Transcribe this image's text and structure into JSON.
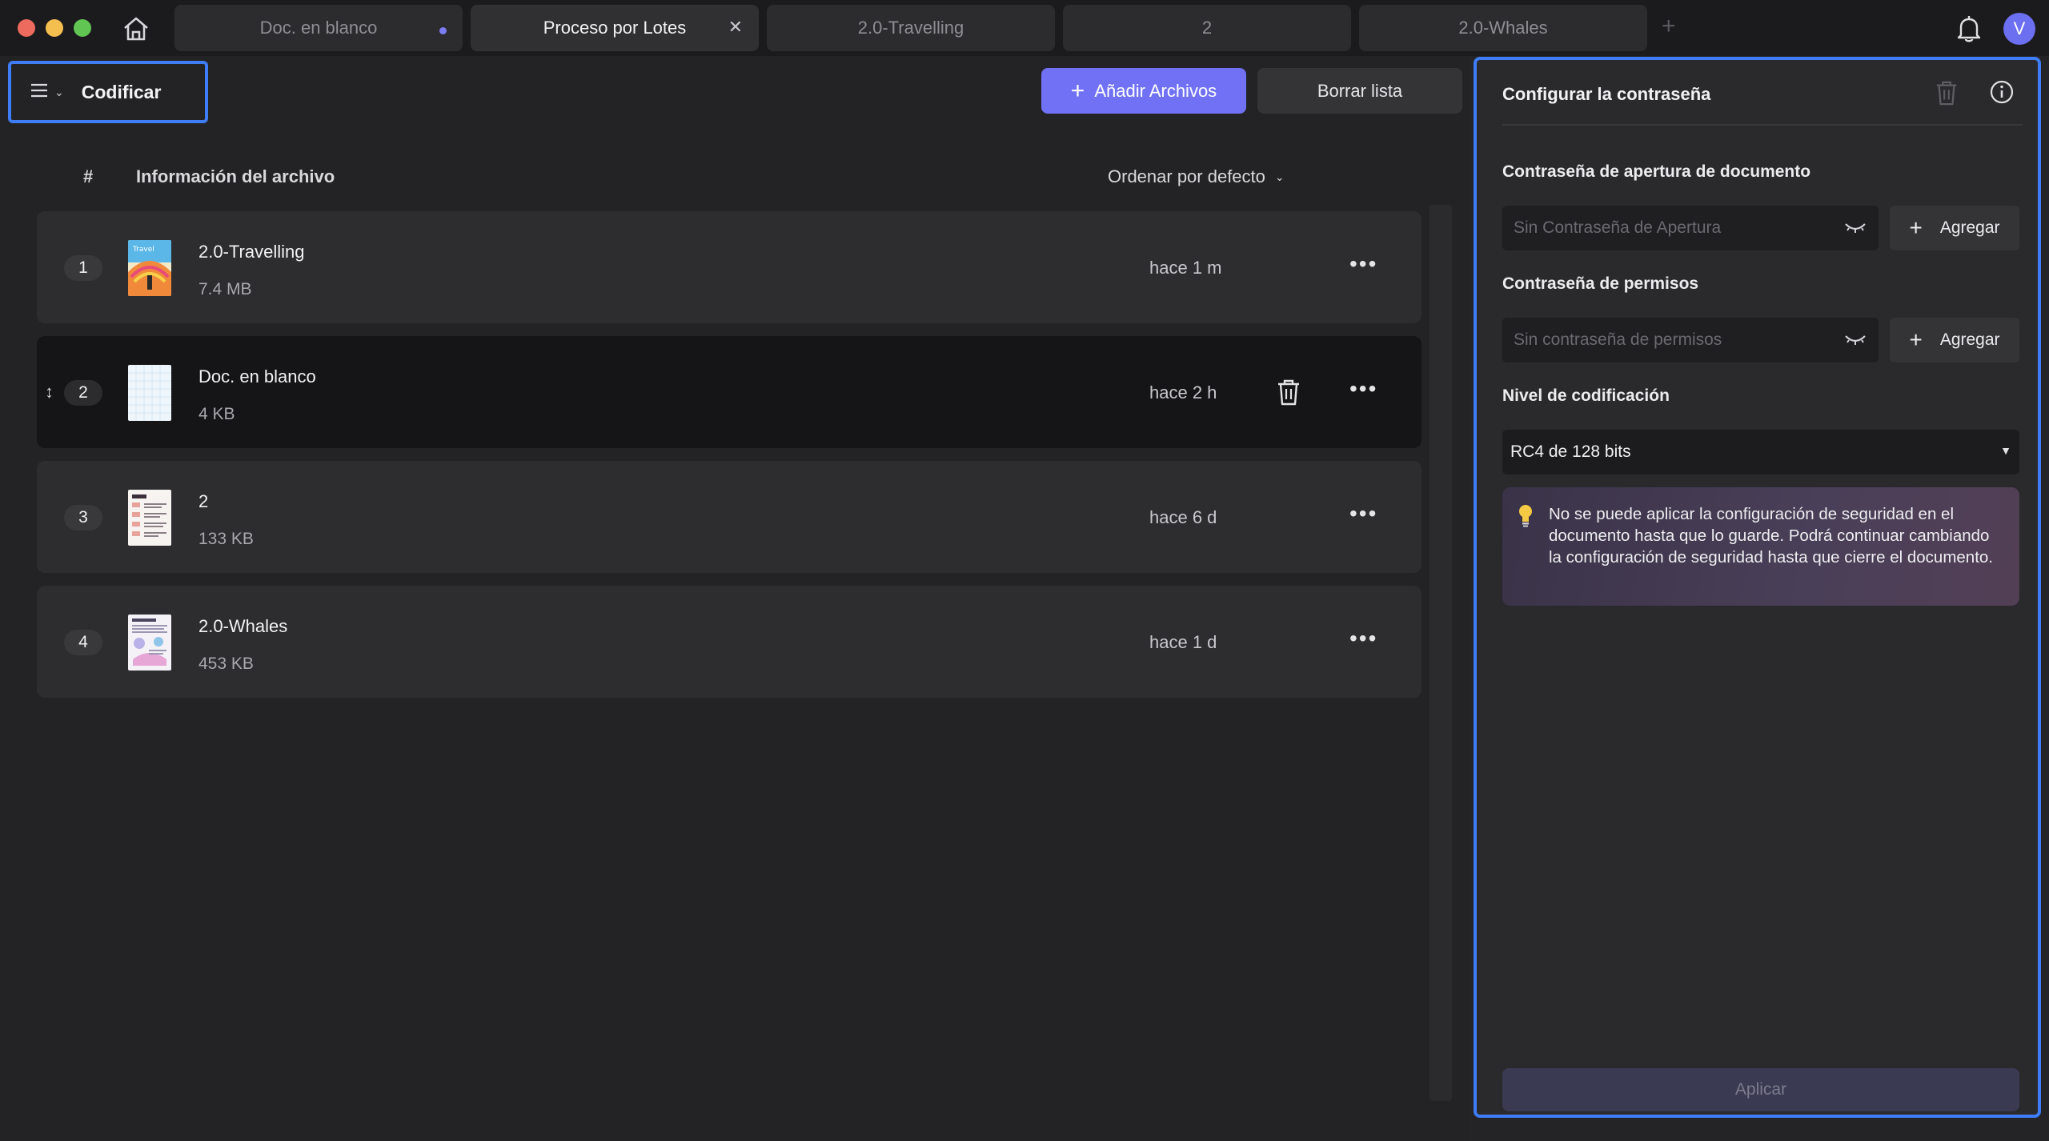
{
  "tabs": [
    {
      "label": "Doc. en blanco",
      "unsaved": true
    },
    {
      "label": "Proceso por Lotes",
      "active": true
    },
    {
      "label": "2.0-Travelling"
    },
    {
      "label": "2"
    },
    {
      "label": "2.0-Whales"
    }
  ],
  "user": {
    "initial": "V"
  },
  "toolbar": {
    "mode_label": "Codificar",
    "add_files_label": "Añadir Archivos",
    "clear_list_label": "Borrar lista"
  },
  "list_header": {
    "hash": "#",
    "info": "Información del archivo",
    "sort_label": "Ordenar por defecto"
  },
  "files": [
    {
      "index": "1",
      "name": "2.0-Travelling",
      "size": "7.4 MB",
      "time": "hace 1 m"
    },
    {
      "index": "2",
      "name": "Doc. en blanco",
      "size": "4 KB",
      "time": "hace 2 h"
    },
    {
      "index": "3",
      "name": "2",
      "size": "133 KB",
      "time": "hace 6 d"
    },
    {
      "index": "4",
      "name": "2.0-Whales",
      "size": "453 KB",
      "time": "hace 1 d"
    }
  ],
  "panel": {
    "title": "Configurar la contraseña",
    "open_pw_label": "Contraseña de apertura de documento",
    "open_pw_placeholder": "Sin Contraseña de Apertura",
    "perm_pw_label": "Contraseña de permisos",
    "perm_pw_placeholder": "Sin contraseña de permisos",
    "add_label": "Agregar",
    "enc_level_label": "Nivel de codificación",
    "enc_level_value": "RC4 de 128 bits",
    "notice": "No se puede aplicar la configuración de seguridad en el documento hasta que lo guarde. Podrá continuar cambiando la configuración de seguridad hasta que cierre el documento.",
    "apply_label": "Aplicar"
  },
  "colors": {
    "accent": "#7071f5",
    "focus_border": "#3f7cf7"
  }
}
